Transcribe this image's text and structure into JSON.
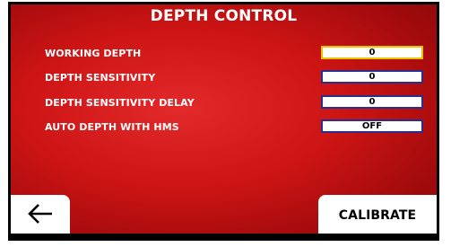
{
  "title": "DEPTH CONTROL",
  "rows": [
    {
      "label": "WORKING DEPTH",
      "value": "0",
      "selected": true
    },
    {
      "label": "DEPTH SENSITIVITY",
      "value": "0",
      "selected": false
    },
    {
      "label": "DEPTH SENSITIVITY DELAY",
      "value": "0",
      "selected": false
    },
    {
      "label": "AUTO DEPTH WITH HMS",
      "value": "OFF",
      "selected": false
    }
  ],
  "buttons": {
    "back_icon": "arrow-left-icon",
    "calibrate_label": "CALIBRATE"
  },
  "colors": {
    "background": "#cc1414",
    "field_border": "#2a2f8f",
    "selected_border": "#e8c400",
    "text": "#ffffff"
  }
}
